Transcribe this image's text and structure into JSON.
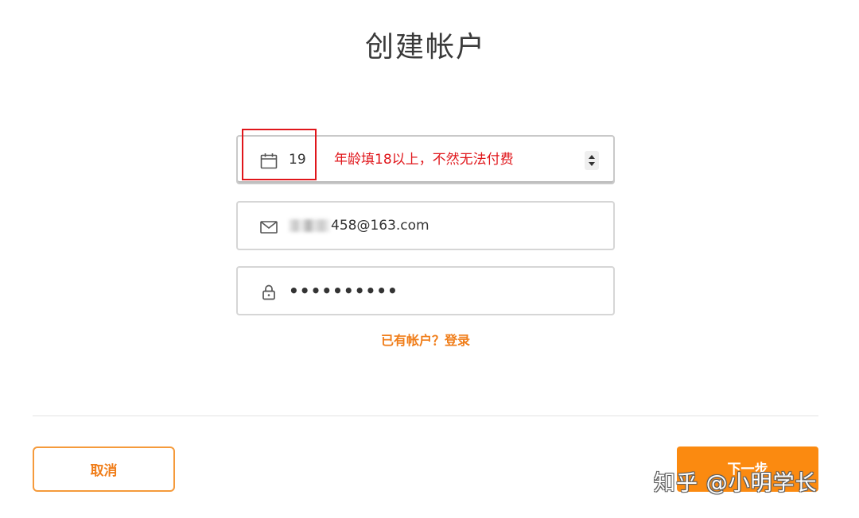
{
  "page": {
    "title": "创建帐户"
  },
  "form": {
    "age": {
      "value": "19",
      "icon": "calendar-icon"
    },
    "email": {
      "value": "458@163.com",
      "icon": "mail-icon"
    },
    "password": {
      "value": "••••••••••",
      "icon": "lock-icon"
    }
  },
  "annotation": {
    "text": "年龄填18以上，不然无法付费",
    "color": "#e0161b"
  },
  "login_link": "已有帐户？登录",
  "footer": {
    "cancel_label": "取消",
    "next_label": "下一步"
  },
  "watermark": "知乎 @小明学长",
  "colors": {
    "accent": "#fb8a10",
    "link": "#f07d19"
  }
}
